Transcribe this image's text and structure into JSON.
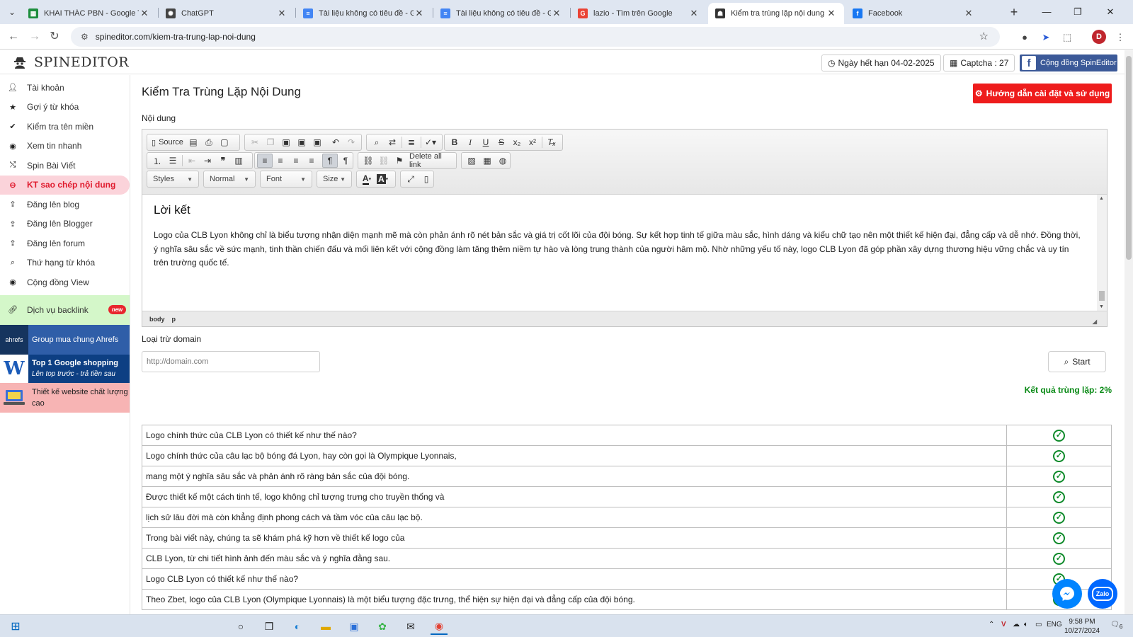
{
  "browser": {
    "tabs": [
      {
        "title": "KHAI THÁC PBN - Google Trang",
        "favicon": "sheets-icon",
        "color": "#1e8e3e"
      },
      {
        "title": "ChatGPT",
        "favicon": "chatgpt-icon",
        "color": "#444444"
      },
      {
        "title": "Tài liệu không có tiêu đề - Goo",
        "favicon": "docs-icon",
        "color": "#4285f4"
      },
      {
        "title": "Tài liệu không có tiêu đề - Goo",
        "favicon": "docs-icon",
        "color": "#4285f4"
      },
      {
        "title": "lazio - Tìm trên Google",
        "favicon": "google-icon",
        "color": "#ea4335"
      },
      {
        "title": "Kiểm tra trùng lặp nội dung",
        "favicon": "spineditor-icon",
        "color": "#333333",
        "active": true
      },
      {
        "title": "Facebook",
        "favicon": "facebook-icon",
        "color": "#1877f2"
      }
    ],
    "url": "spineditor.com/kiem-tra-trung-lap-noi-dung",
    "profile_initial": "D"
  },
  "header": {
    "logo_text": "SPINEDITOR",
    "expiry": "Ngày hết hạn 04-02-2025",
    "captcha": "Captcha : 27",
    "community": "Cộng đồng SpinEditor"
  },
  "sidebar": {
    "items": [
      {
        "label": "Tài khoản",
        "icon": "user-icon"
      },
      {
        "label": "Gợi ý từ khóa",
        "icon": "star-icon"
      },
      {
        "label": "Kiểm tra tên miền",
        "icon": "check-icon"
      },
      {
        "label": "Xem tin nhanh",
        "icon": "eye-icon"
      },
      {
        "label": "Spin Bài Viết",
        "icon": "shuffle-icon"
      },
      {
        "label": "KT sao chép nội dung",
        "icon": "circle-icon",
        "active": true
      },
      {
        "label": "Đăng lên blog",
        "icon": "upload-icon"
      },
      {
        "label": "Đăng lên Blogger",
        "icon": "upload-icon"
      },
      {
        "label": "Đăng lên forum",
        "icon": "upload-icon"
      },
      {
        "label": "Thứ hạng từ khóa",
        "icon": "search-icon"
      },
      {
        "label": "Cộng đồng View",
        "icon": "eye-icon"
      }
    ],
    "backlink": {
      "label": "Dịch vụ backlink",
      "badge": "new"
    },
    "banners": {
      "ahrefs": {
        "label": "Group mua chung Ahrefs",
        "icon_text": "ahrefs"
      },
      "google": {
        "title": "Top 1 Google shopping",
        "subtitle": "Lên top trước - trả tiền sau"
      },
      "web": {
        "label": "Thiết kế website chất lượng cao"
      }
    }
  },
  "main": {
    "title": "Kiểm Tra Trùng Lặp Nội Dung",
    "guide_button": "Hướng dẫn cài đặt và sử dụng",
    "content_label": "Nội dung",
    "toolbar": {
      "source": "Source",
      "delete_all_link": "Delete all link",
      "styles": "Styles",
      "format": "Normal",
      "font": "Font",
      "size": "Size"
    },
    "editor": {
      "heading": "Lời kết",
      "paragraph": "Logo của CLB Lyon không chỉ là biểu tượng nhận diện mạnh mẽ mà còn phản ánh rõ nét bản sắc và giá trị cốt lõi của đội bóng. Sự kết hợp tinh tế giữa màu sắc, hình dáng và kiểu chữ tạo nên một thiết kế hiện đại, đẳng cấp và dễ nhớ. Đồng thời, ý nghĩa sâu sắc về sức mạnh, tinh thần chiến đấu và mối liên kết với cộng đồng làm tăng thêm niềm tự hào và lòng trung thành của người hâm mộ. Nhờ những yếu tố này, logo CLB Lyon đã góp phần xây dựng thương hiệu vững chắc và uy tín trên trường quốc tế.",
      "path_body": "body",
      "path_p": "p"
    },
    "exclude_label": "Loại trừ domain",
    "domain_placeholder": "http://domain.com",
    "start_button": "Start",
    "result": "Kết quả trùng lặp: 2%",
    "rows": [
      "Logo chính thức của CLB Lyon có thiết kế như thế nào?",
      "Logo chính thức của câu lạc bộ bóng đá Lyon, hay còn gọi là Olympique Lyonnais,",
      "mang một ý nghĩa sâu sắc và phản ánh rõ ràng bản sắc của đội bóng.",
      "Được thiết kế một cách tinh tế, logo không chỉ tượng trưng cho truyền thống và",
      "lịch sử lâu đời mà còn khẳng định phong cách và tầm vóc của câu lạc bộ.",
      "Trong bài viết này, chúng ta sẽ khám phá kỹ hơn về thiết kế logo của",
      "CLB Lyon, từ chi tiết hình ảnh đến màu sắc và ý nghĩa đằng sau.",
      "Logo CLB Lyon có thiết kế như thế nào?",
      "Theo Zbet, logo của CLB Lyon (Olympique Lyonnais) là một biểu tượng đặc trưng, thể hiện sự hiện đại và đẳng cấp của đội bóng."
    ]
  },
  "taskbar": {
    "lang": "ENG",
    "time": "9:58 PM",
    "date": "10/27/2024",
    "notifications": "6"
  },
  "colors": {
    "accent_red": "#ee1c1c",
    "active_pink": "#fbd3da",
    "result_green": "#0a8a16",
    "facebook": "#3b5998"
  }
}
